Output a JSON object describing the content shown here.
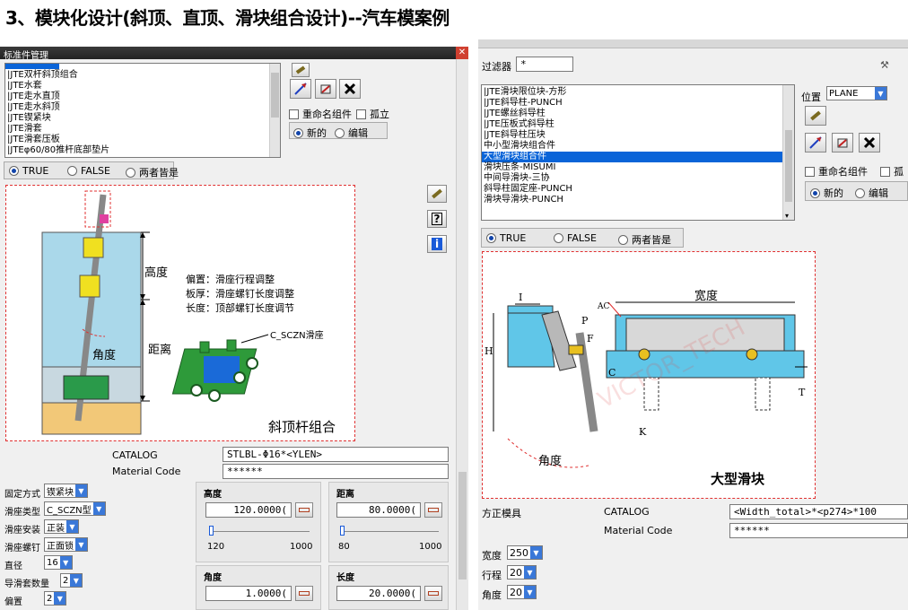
{
  "title": "3、模块化设计(斜顶、直顶、滑块组合设计)--汽车模案例",
  "left": {
    "window_title": "标准件管理",
    "close_glyph": "✕",
    "list_items": [
      "|JTE双杆斜顶组合",
      "|JTE水套",
      "|JTE走水直顶",
      "|JTE走水斜顶",
      "|JTE锲紧块",
      "|JTE滑套",
      "|JTE滑套压板",
      "|JTEφ60/80推杆底部垫片"
    ],
    "rename_label": "重命名组件",
    "isolate_label": "孤立",
    "new_label": "新的",
    "edit_label": "编辑",
    "true_label": "TRUE",
    "false_label": "FALSE",
    "both_label": "两者皆是",
    "diagram": {
      "height": "高度",
      "distance": "距离",
      "angle": "角度",
      "note1": "偏置：滑座行程调整",
      "note2": "板厚：滑座螺钉长度调整",
      "note3": "长度：顶部螺钉长度调节",
      "slider_label": "C_SCZN滑座",
      "caption": "斜顶杆组合"
    },
    "catalog_label": "CATALOG",
    "catalog_value": "STLBL-Φ16*<YLEN>",
    "material_label": "Material Code",
    "material_value": "******",
    "params": [
      {
        "label": "固定方式",
        "value": "锲紧块"
      },
      {
        "label": "滑座类型",
        "value": "C_SCZN型"
      },
      {
        "label": "滑座安装",
        "value": "正装"
      },
      {
        "label": "滑座螺钉",
        "value": "正面锁"
      },
      {
        "label": "直径",
        "value": "16"
      },
      {
        "label": "导滑套数量",
        "value": "2"
      },
      {
        "label": "偏置",
        "value": "2"
      }
    ],
    "dims": [
      {
        "label": "高度",
        "value": "120.0000(",
        "min": "120",
        "max": "1000",
        "level": 0
      },
      {
        "label": "距离",
        "value": "80.0000(",
        "min": "80",
        "max": "1000",
        "level": 0
      },
      {
        "label": "角度",
        "value": "1.0000("
      },
      {
        "label": "长度",
        "value": "20.0000("
      }
    ]
  },
  "right": {
    "filter_label": "过滤器",
    "filter_value": "*",
    "list_items": [
      "|JTE滑块限位块-方形",
      "|JTE斜导柱-PUNCH",
      "|JTE螺丝斜导柱",
      "|JTE压板式斜导柱",
      "|JTE斜导柱压块",
      "中小型滑块组合件",
      "大型滑块组合件",
      "滑块压条-MISUMI",
      "中间导滑块-三协",
      "斜导柱固定座-PUNCH",
      "滑块导滑块-PUNCH"
    ],
    "selected_index": 6,
    "position_label": "位置",
    "position_value": "PLANE",
    "rename_label": "重命名组件",
    "isolate_label": "孤",
    "new_label": "新的",
    "edit_label": "编辑",
    "true_label": "TRUE",
    "false_label": "FALSE",
    "both_label": "两者皆是",
    "diagram": {
      "width": "宽度",
      "angle": "角度",
      "caption": "大型滑块",
      "watermark": "VICTOR_TECH",
      "labels": [
        "I",
        "H",
        "P",
        "F",
        "AC",
        "C",
        "K",
        "T"
      ]
    },
    "mold_label": "方正模具",
    "catalog_label": "CATALOG",
    "catalog_value": "<Width_total>*<p274>*100",
    "material_label": "Material Code",
    "material_value": "******",
    "params": [
      {
        "label": "宽度",
        "value": "250"
      },
      {
        "label": "行程",
        "value": "20"
      },
      {
        "label": "角度",
        "value": "20"
      }
    ]
  },
  "colors": {
    "accent": "#0a64d8",
    "cyan": "#5ec8e8",
    "red_dash": "#e03030",
    "green": "#1f9a4a"
  }
}
